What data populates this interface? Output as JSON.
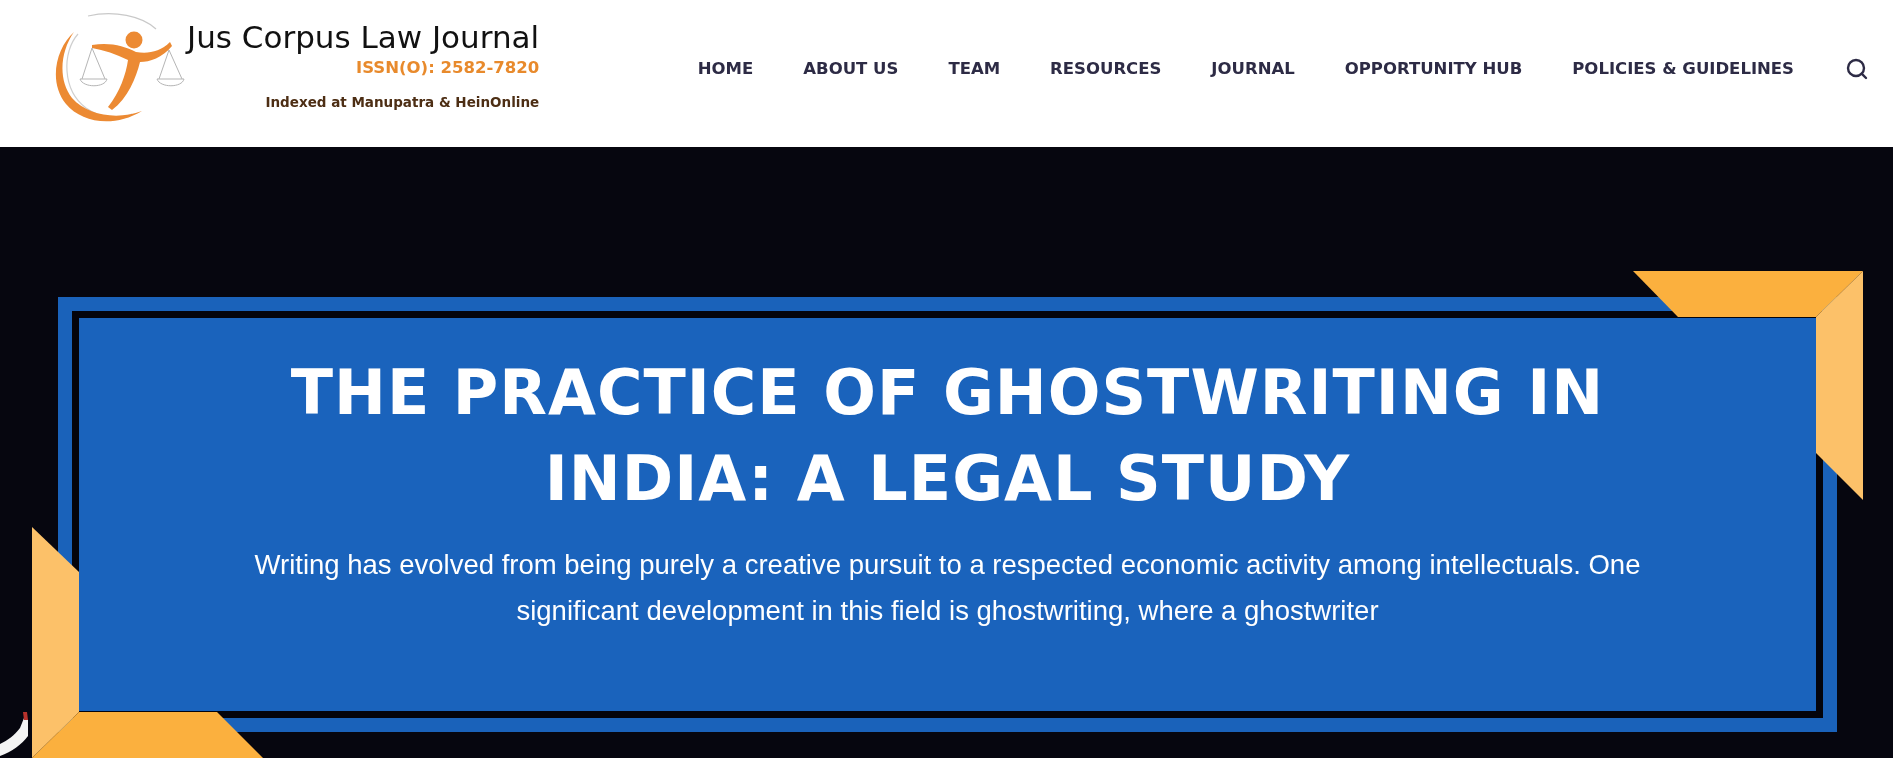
{
  "header": {
    "logo": {
      "title": "Jus Corpus Law Journal",
      "issn": "ISSN(O): 2582-7820",
      "indexed": "Indexed at Manupatra & HeinOnline"
    },
    "nav": [
      "HOME",
      "ABOUT US",
      "TEAM",
      "RESOURCES",
      "JOURNAL",
      "OPPORTUNITY HUB",
      "POLICIES & GUIDELINES"
    ]
  },
  "hero": {
    "title": "THE PRACTICE OF GHOSTWRITING IN INDIA: A LEGAL STUDY",
    "excerpt": "Writing has evolved from being purely a creative pursuit to a respected economic activity among intellectuals. One significant development in this field is ghostwriting, where a ghostwriter"
  }
}
